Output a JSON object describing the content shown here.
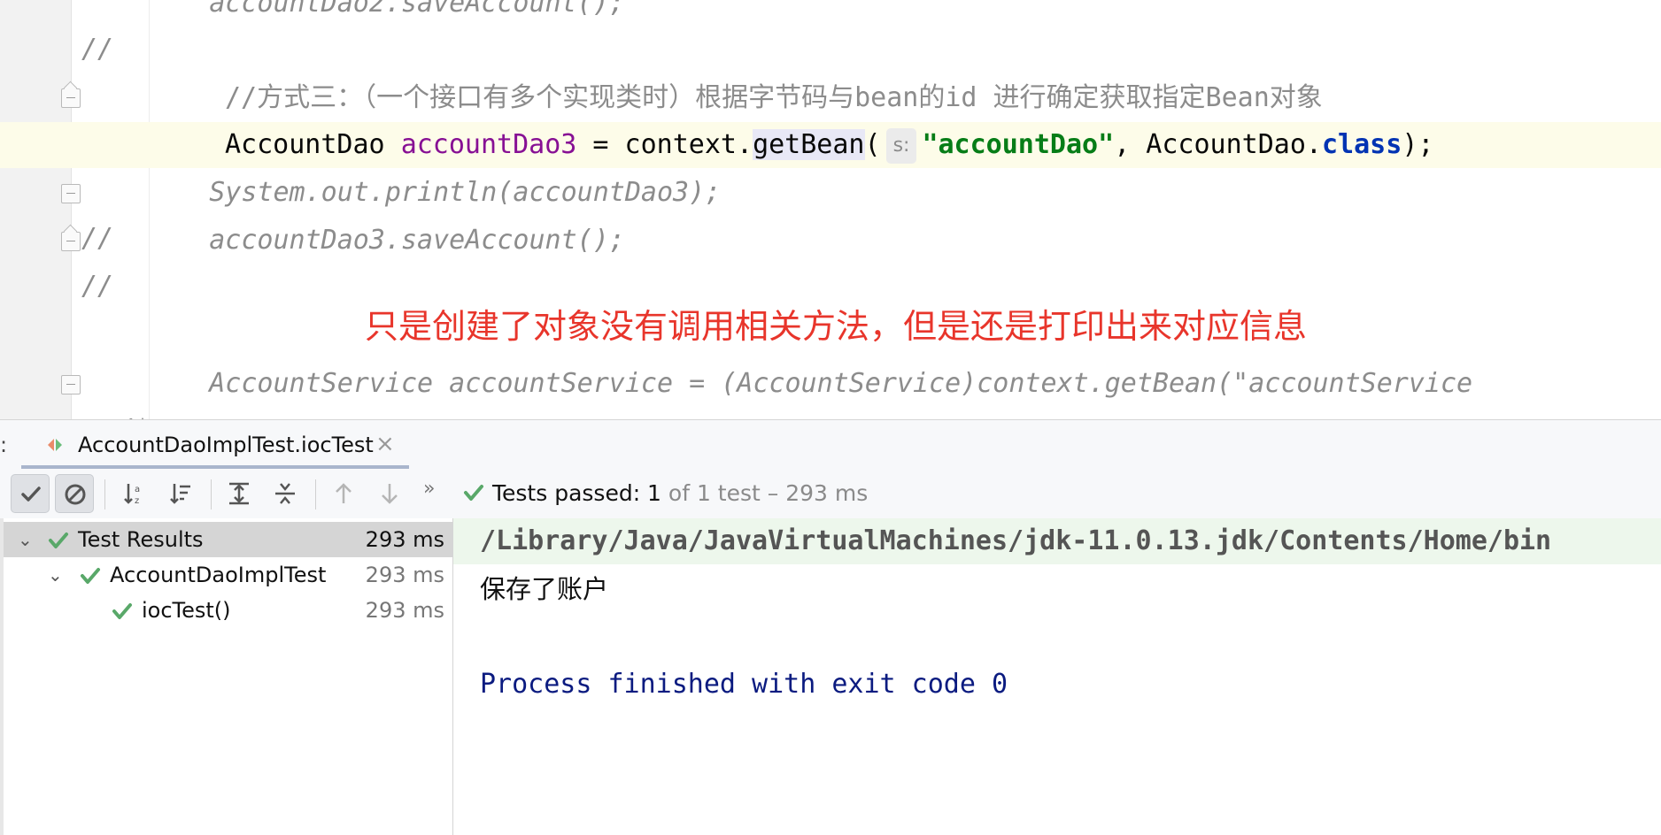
{
  "editor": {
    "lines": [
      {
        "marker": "//",
        "code": "    accountDao2.saveAccount();"
      },
      {
        "comment": "//方式三：（一个接口有多个实现类时）根据字节码与bean的id 进行确定获取指定Bean对象"
      },
      {
        "type_name": "AccountDao",
        "var_name": "accountDao3",
        "assign": " = context.",
        "method": "getBean",
        "open_paren": "(",
        "hint": "s:",
        "string_arg": "\"accountDao\"",
        "rest": ", AccountDao.",
        "keyword": "class",
        "close": ");"
      },
      {
        "marker": "//",
        "code": "    System.out.println(accountDao3);"
      },
      {
        "marker": "//",
        "code": "    accountDao3.saveAccount();"
      },
      {
        "marker": "/*",
        "code": "    AccountService accountService = (AccountService)context.getBean(\"accountService"
      }
    ],
    "annotation": "只是创建了对象没有调用相关方法，但是还是打印出来对应信息"
  },
  "run": {
    "tab_prefix": ":",
    "tab_label": "AccountDaoImplTest.iocTest",
    "tab_close": "×",
    "more": "»",
    "summary": {
      "passed_label": "Tests passed: 1",
      "rest": " of 1 test – 293 ms"
    },
    "tree": [
      {
        "label": "Test Results",
        "duration": "293 ms"
      },
      {
        "label": "AccountDaoImplTest",
        "duration": "293 ms"
      },
      {
        "label": "iocTest()",
        "duration": "293 ms"
      }
    ],
    "console": {
      "command": "/Library/Java/JavaVirtualMachines/jdk-11.0.13.jdk/Contents/Home/bin",
      "output": "保存了账户",
      "exit": "Process finished with exit code 0"
    }
  },
  "colors": {
    "pass_green": "#59a869",
    "annotation_red": "#e8352b",
    "string_green": "#067d17",
    "keyword_blue": "#0033b3"
  }
}
